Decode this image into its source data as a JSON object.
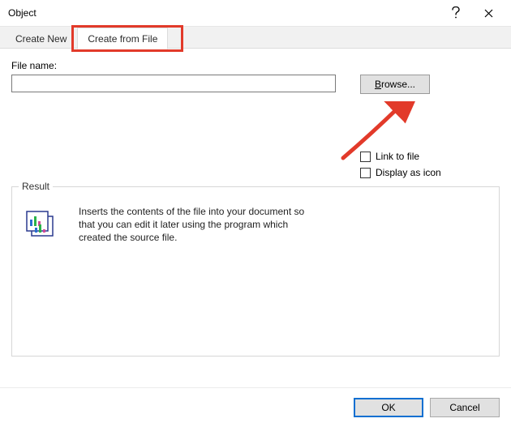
{
  "title": "Object",
  "tabs": {
    "create_new": "Create New",
    "create_from_file": "Create from File"
  },
  "file_name_label": "File name:",
  "file_name_value": "",
  "browse_prefix": "B",
  "browse_rest": "rowse...",
  "checkboxes": {
    "link": "Link to file",
    "icon": "Display as icon"
  },
  "result": {
    "legend": "Result",
    "description": "Inserts the contents of the file into your document so that you can edit it later using the program which created the source file."
  },
  "buttons": {
    "ok": "OK",
    "cancel": "Cancel"
  }
}
